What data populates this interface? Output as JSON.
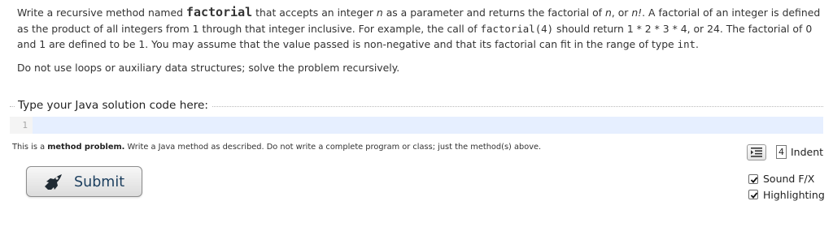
{
  "prompt": {
    "p1": [
      {
        "t": "Write a recursive method named "
      },
      {
        "t": "factorial",
        "style": "code-big"
      },
      {
        "t": " that accepts an integer "
      },
      {
        "t": "n",
        "style": "italic"
      },
      {
        "t": " as a parameter and returns the factorial of "
      },
      {
        "t": "n",
        "style": "italic"
      },
      {
        "t": ", or "
      },
      {
        "t": "n!",
        "style": "italic"
      },
      {
        "t": ". A factorial of an integer is defined as the product of all integers from 1 through that integer inclusive. For example, the call of "
      },
      {
        "t": "factorial(4)",
        "style": "code"
      },
      {
        "t": " should return 1 * 2 * 3 * 4, or 24. The factorial of 0 and 1 are defined to be 1. You may assume that the value passed is non-negative and that its factorial can fit in the range of type "
      },
      {
        "t": "int",
        "style": "code"
      },
      {
        "t": "."
      }
    ],
    "p2": "Do not use loops or auxiliary data structures; solve the problem recursively."
  },
  "editor": {
    "legend": "Type your Java solution code here:",
    "line_number": "1",
    "code": ""
  },
  "note": {
    "prefix": "This is a ",
    "bold": "method problem.",
    "suffix": " Write a Java method as described. Do not write a complete program or class; just the method(s) above."
  },
  "submit": {
    "label": "Submit",
    "icon": "rocket-icon"
  },
  "options": {
    "indent_value": "4",
    "indent_label": "Indent",
    "indent_icon": "indent-icon",
    "sound_label": "Sound F/X",
    "sound_checked": true,
    "highlight_label": "Highlighting",
    "highlight_checked": true
  },
  "colors": {
    "editor_bg": "#e6efff",
    "submit_text": "#1b3e5e",
    "rocket": "#1f2a33"
  }
}
